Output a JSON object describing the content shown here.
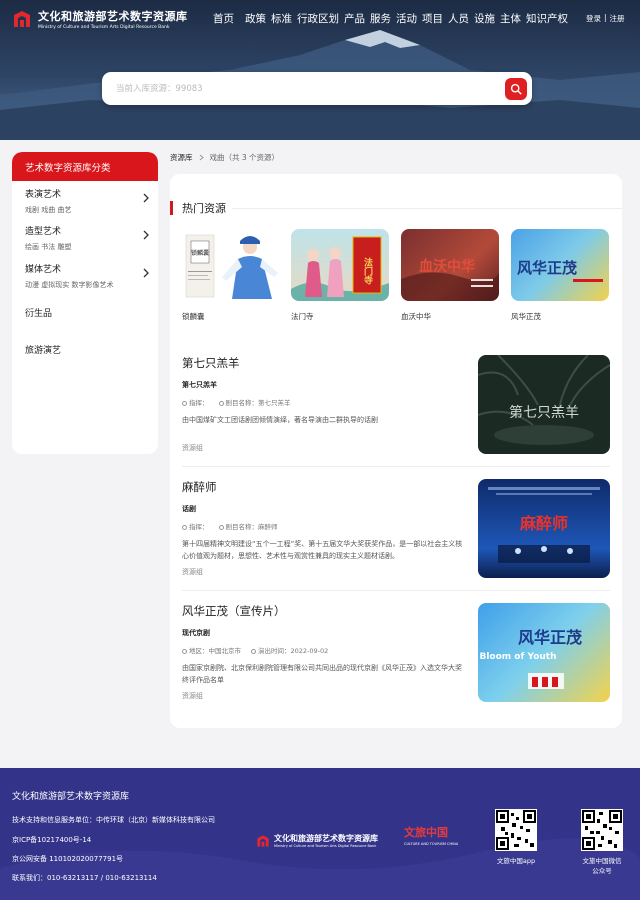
{
  "header": {
    "logo_title": "文化和旅游部艺术数字资源库",
    "logo_subtitle": "Ministry of Culture and Tourism Arts Digital Resource Bank",
    "nav": [
      "首页",
      "政策",
      "标准",
      "行政区划",
      "产品",
      "服务",
      "活动",
      "项目",
      "人员",
      "设施",
      "主体",
      "知识产权"
    ],
    "login": "登录",
    "separator": "|",
    "register": "注册"
  },
  "search": {
    "placeholder": "当前入库资源：99083"
  },
  "sidebar": {
    "title": "艺术数字资源库分类",
    "items": [
      {
        "name": "表演艺术",
        "subs": "戏剧  戏曲  曲艺",
        "has_children": true
      },
      {
        "name": "造型艺术",
        "subs": "绘画  书法  雕塑",
        "has_children": true
      },
      {
        "name": "媒体艺术",
        "subs": "动漫  虚拟现实  数字影像艺术",
        "has_children": true
      },
      {
        "name": "衍生品",
        "subs": "",
        "has_children": false
      },
      {
        "name": "旅游演艺",
        "subs": "",
        "has_children": false
      }
    ]
  },
  "breadcrumb": {
    "home": "资源库",
    "current": "戏曲（共 3 个资源）"
  },
  "hot": {
    "title": "热门资源",
    "items": [
      {
        "caption": "锁麟囊",
        "poster_text": "锁麟囊"
      },
      {
        "caption": "法门寺",
        "poster_text": "法门寺"
      },
      {
        "caption": "血沃中华",
        "poster_text": "血沃中华"
      },
      {
        "caption": "风华正茂",
        "poster_text": "风华正茂"
      }
    ]
  },
  "entries": [
    {
      "title": "第七只羔羊",
      "type": "第七只羔羊",
      "meta1": "指挥：",
      "meta2": "剧目名称：第七只羔羊",
      "desc": "由中国煤矿文工团话剧团倾情演绎，著名导演由二群执导的话剧",
      "source": "资源组",
      "poster_text": "第七只羔羊"
    },
    {
      "title": "麻醉师",
      "type": "话剧",
      "meta1": "指挥：",
      "meta2": "剧目名称：麻醉师",
      "desc": "第十四届精神文明建设“五个一工程”奖、第十五届文华大奖获奖作品，是一部以社会主义核心价值观为题材，思想性、艺术性与观赏性兼具的现实主义题材话剧。",
      "source": "资源组",
      "poster_text": "麻醉师"
    },
    {
      "title": "风华正茂（宣传片）",
      "type": "现代京剧",
      "meta1": "地区：中国北京市",
      "meta2": "演出时间：2022-09-02",
      "desc": "由国家京剧院、北京保利剧院管理有限公司共同出品的现代京剧《风华正茂》入选文华大奖终评作品名单",
      "source": "资源组",
      "poster_text": "风华正茂",
      "poster_en": "Bloom of Youth"
    }
  ],
  "footer": {
    "title": "文化和旅游部艺术数字资源库",
    "support": "技术支持和信息服务单位：中传环球（北京）新媒体科技有限公司",
    "icp": "京ICP备10217400号-14",
    "police": "京公网安备 110102020077791号",
    "contact": "联系我们：010-63213117 / 010-63213114",
    "logo_title": "文化和旅游部艺术数字资源库",
    "logo_subtitle": "Ministry of Culture and Tourism Arts Digital Resource Bank",
    "partner_logo": "文旅中国",
    "partner_en": "CULTURE AND TOURISM CHINA",
    "qr1_caption": "文旅中国app",
    "qr2_caption_line1": "文旅中国微信",
    "qr2_caption_line2": "公众号"
  },
  "colors": {
    "accent": "#d8161b",
    "footer_bg": "#33338a",
    "hero_dark": "#1d2b44"
  }
}
